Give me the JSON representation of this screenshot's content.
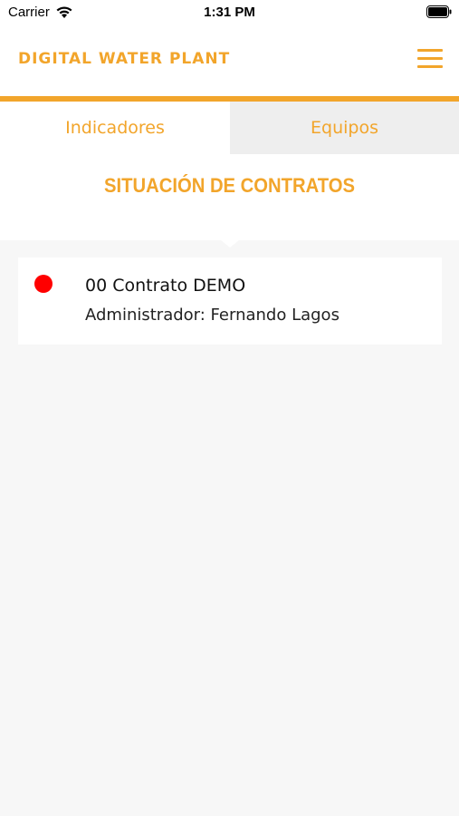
{
  "status_bar": {
    "carrier": "Carrier",
    "time": "1:31 PM"
  },
  "header": {
    "title": "DIGITAL WATER PLANT",
    "menu_icon": "hamburger-menu-icon"
  },
  "tabs": [
    {
      "label": "Indicadores",
      "active": true
    },
    {
      "label": "Equipos",
      "active": false
    }
  ],
  "section": {
    "title": "SITUACIÓN DE CONTRATOS"
  },
  "contracts": [
    {
      "name": "00 Contrato DEMO",
      "admin": "Administrador: Fernando Lagos",
      "status_color": "#ff0000"
    }
  ],
  "colors": {
    "accent": "#f2a52b",
    "background": "#f7f7f7",
    "inactive_tab": "#eeeeee",
    "status_red": "#ff0000"
  }
}
